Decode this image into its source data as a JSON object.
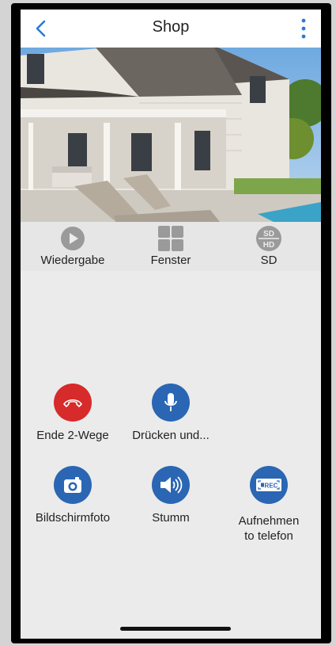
{
  "header": {
    "title": "Shop"
  },
  "controls": {
    "playback_label": "Wiedergabe",
    "window_label": "Fenster",
    "quality_label": "SD",
    "quality_badge_top": "SD",
    "quality_badge_bottom": "HD"
  },
  "actions": {
    "end_two_way_label": "Ende 2-Wege",
    "push_to_talk_label": "Drücken und...",
    "screenshot_label": "Bildschirmfoto",
    "mute_label": "Stumm",
    "record_label_line1": "Aufnehmen",
    "record_label_line2": "to telefon",
    "rec_badge": "REC"
  },
  "colors": {
    "accent_blue": "#2a66b3",
    "hangup_red": "#d72a2a",
    "back_blue": "#2a7ad6"
  },
  "icons": {
    "back": "chevron-left-icon",
    "menu": "more-vertical-icon",
    "playback": "play-circle-icon",
    "window": "grid-icon",
    "quality": "sd-hd-icon",
    "hangup": "phone-hangup-icon",
    "talk": "microphone-icon",
    "screenshot": "camera-icon",
    "mute": "speaker-icon",
    "record": "rec-icon"
  }
}
